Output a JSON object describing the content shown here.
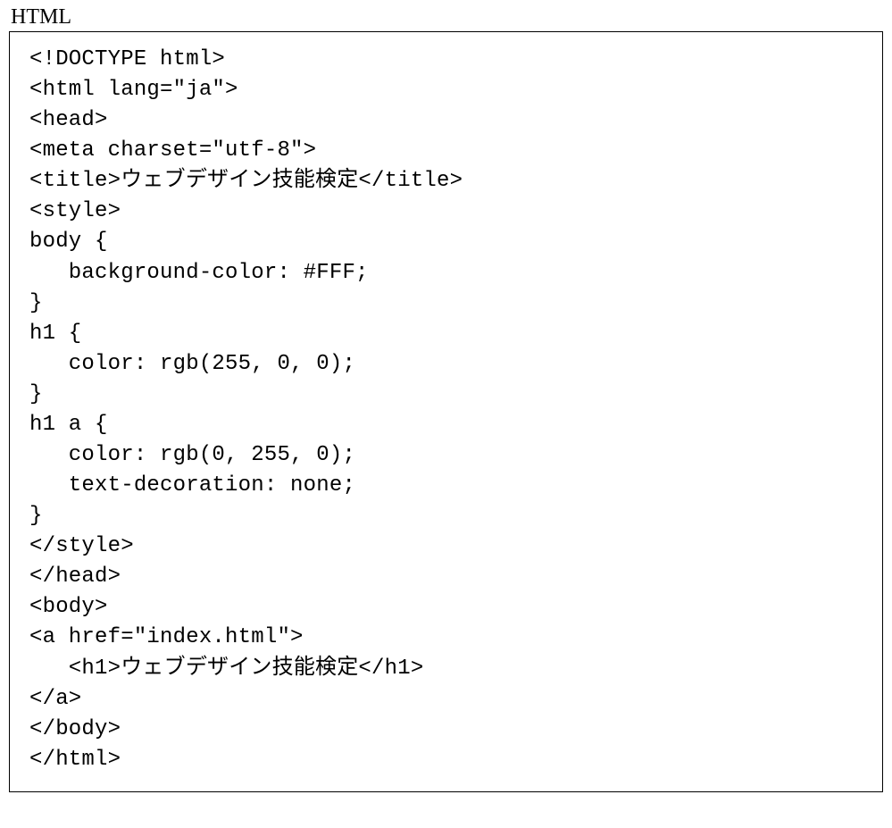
{
  "label": "HTML",
  "code_lines": [
    "<!DOCTYPE html>",
    "<html lang=\"ja\">",
    "<head>",
    "<meta charset=\"utf-8\">",
    "<title>ウェブデザイン技能検定</title>",
    "<style>",
    "body {",
    "   background-color: #FFF;",
    "}",
    "h1 {",
    "   color: rgb(255, 0, 0);",
    "}",
    "h1 a {",
    "   color: rgb(0, 255, 0);",
    "   text-decoration: none;",
    "}",
    "</style>",
    "</head>",
    "<body>",
    "<a href=\"index.html\">",
    "   <h1>ウェブデザイン技能検定</h1>",
    "</a>",
    "</body>",
    "</html>"
  ]
}
